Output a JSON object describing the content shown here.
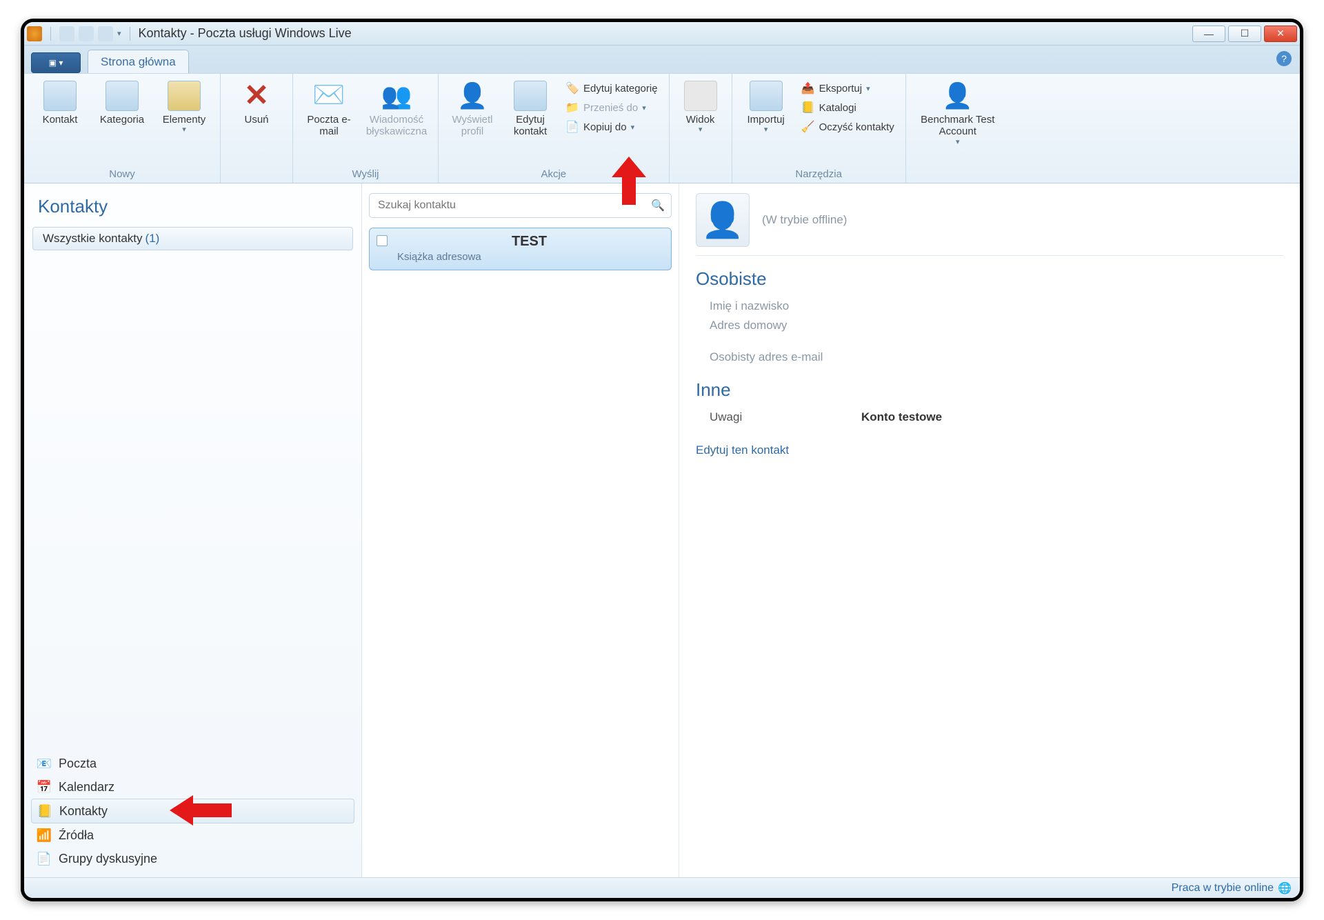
{
  "window": {
    "title": "Kontakty - Poczta usługi Windows Live"
  },
  "tabs": {
    "main": "Strona główna"
  },
  "ribbon": {
    "groups": {
      "nowy": {
        "label": "Nowy",
        "kontakt": "Kontakt",
        "kategoria": "Kategoria",
        "elementy": "Elementy"
      },
      "usun": {
        "label": "Usuń"
      },
      "wyslij": {
        "label": "Wyślij",
        "email": "Poczta e-mail",
        "im": "Wiadomość błyskawiczna"
      },
      "akcje": {
        "label": "Akcje",
        "profil": "Wyświetl profil",
        "edytuj": "Edytuj kontakt",
        "edytuj_kat": "Edytuj kategorię",
        "przenies": "Przenieś do",
        "kopiuj": "Kopiuj do"
      },
      "widok": {
        "label": "Widok"
      },
      "narzedzia": {
        "label": "Narzędzia",
        "importuj": "Importuj",
        "eksportuj": "Eksportuj",
        "katalogi": "Katalogi",
        "oczysc": "Oczyść kontakty"
      },
      "konto": {
        "label": "Benchmark Test Account"
      }
    }
  },
  "sidebar": {
    "title": "Kontakty",
    "all_label": "Wszystkie kontakty",
    "all_count": "(1)",
    "nav": {
      "poczta": "Poczta",
      "kalendarz": "Kalendarz",
      "kontakty": "Kontakty",
      "zrodla": "Źródła",
      "grupy": "Grupy dyskusyjne"
    }
  },
  "search": {
    "placeholder": "Szukaj kontaktu"
  },
  "list": {
    "item": {
      "name": "TEST",
      "sub": "Książka adresowa"
    }
  },
  "detail": {
    "status": "(W trybie offline)",
    "osobiste": {
      "header": "Osobiste",
      "name_label": "Imię i nazwisko",
      "addr_label": "Adres domowy",
      "email_label": "Osobisty adres e-mail"
    },
    "inne": {
      "header": "Inne",
      "uwagi_label": "Uwagi",
      "uwagi_value": "Konto testowe"
    },
    "edit_link": "Edytuj ten kontakt"
  },
  "statusbar": {
    "online": "Praca w trybie online"
  }
}
